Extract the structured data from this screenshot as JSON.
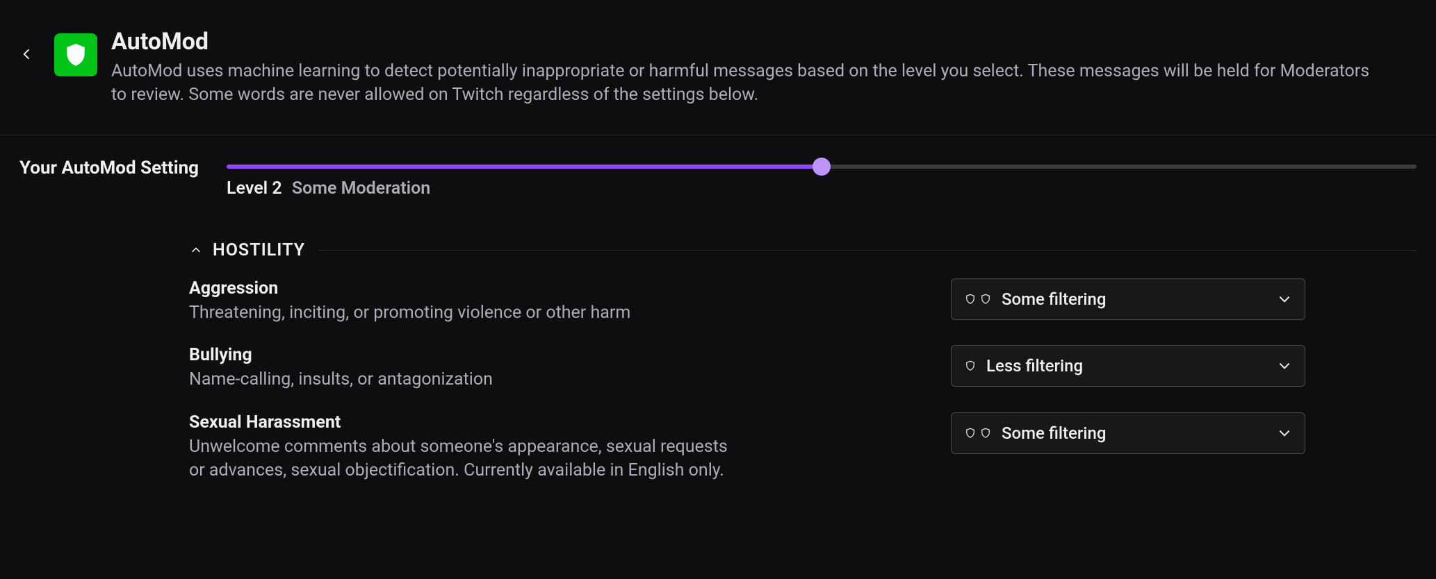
{
  "header": {
    "title": "AutoMod",
    "description": "AutoMod uses machine learning to detect potentially inappropriate or harmful messages based on the level you select. These messages will be held for Moderators to review. Some words are never allowed on Twitch regardless of the settings below."
  },
  "setting": {
    "label": "Your AutoMod Setting",
    "slider_percent": 50,
    "level_text": "Level 2",
    "level_label": "Some Moderation"
  },
  "category": {
    "title": "HOSTILITY",
    "items": [
      {
        "title": "Aggression",
        "desc": "Threatening, inciting, or promoting violence or other harm",
        "shields": 2,
        "value": "Some filtering"
      },
      {
        "title": "Bullying",
        "desc": "Name-calling, insults, or antagonization",
        "shields": 1,
        "value": "Less filtering"
      },
      {
        "title": "Sexual Harassment",
        "desc": "Unwelcome comments about someone's appearance, sexual requests or advances, sexual objectification. Currently available in English only.",
        "shields": 2,
        "value": "Some filtering"
      }
    ]
  }
}
